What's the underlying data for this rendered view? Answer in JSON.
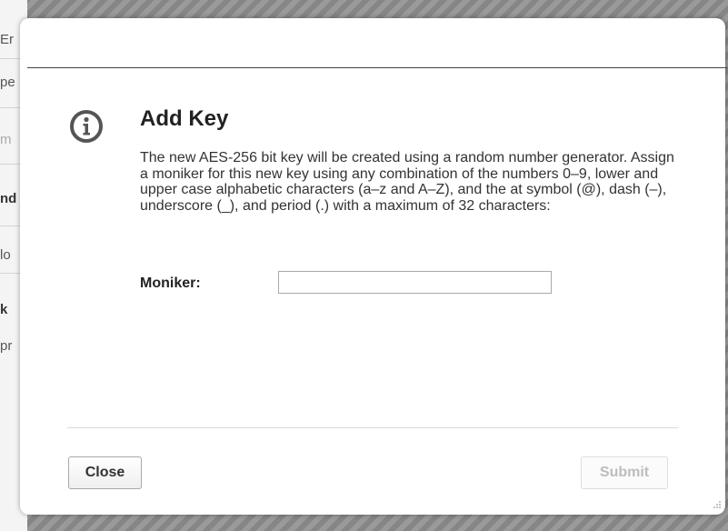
{
  "background": {
    "fragments": [
      "Er",
      "pe",
      "m",
      "nd",
      "lo",
      "k",
      "pr"
    ]
  },
  "dialog": {
    "title": "Add Key",
    "description": "The new AES-256 bit key will be created using a random number generator. Assign a moniker for this new key using any combination of the numbers 0–9, lower and upper case alphabetic characters (a–z and A–Z), and the at symbol (@), dash (–), underscore (_), and period (.) with a maximum of 32 characters:",
    "moniker_label": "Moniker:",
    "moniker_value": "",
    "moniker_placeholder": "",
    "icon": "info-icon",
    "buttons": {
      "close": "Close",
      "submit": "Submit",
      "submit_disabled": true
    }
  },
  "colors": {
    "overlay": "#8e8e8e",
    "dialog_bg": "#ffffff",
    "text": "#333333",
    "disabled_text": "#bdbdbd"
  }
}
